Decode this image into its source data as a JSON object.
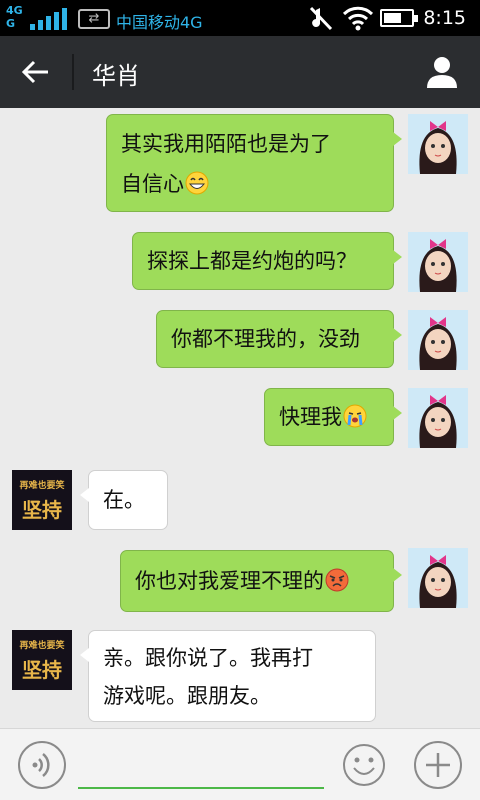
{
  "status_bar": {
    "network_badge_top": "4G",
    "network_badge_bottom": "G",
    "data_arrows": "⇄",
    "carrier": "中国移动4G",
    "battery_level": 0.6,
    "time": "8:15",
    "accent": "#2fb4e8"
  },
  "header": {
    "title": "华肖",
    "back_icon": "arrow-left-icon",
    "profile_icon": "person-icon"
  },
  "messages": [
    {
      "side": "right",
      "lines": [
        "其实我用陌陌也是为了",
        "自信心"
      ],
      "emoji": "grin-emoji"
    },
    {
      "side": "right",
      "lines": [
        "探探上都是约炮的吗？"
      ]
    },
    {
      "side": "right",
      "lines": [
        "你都不理我的，没劲"
      ]
    },
    {
      "side": "right",
      "lines": [
        "快理我"
      ],
      "emoji": "crying-emoji"
    },
    {
      "side": "left",
      "lines": [
        "在。"
      ]
    },
    {
      "side": "right",
      "lines": [
        "你也对我爱理不理的"
      ],
      "emoji": "angry-emoji"
    },
    {
      "side": "left",
      "lines": [
        "亲。跟你说了。我再打",
        "游戏呢。跟朋友。"
      ]
    }
  ],
  "avatar_left_text": [
    "再难也要笑",
    "坚持"
  ],
  "input_bar": {
    "input_value": "",
    "voice_icon": "voice-icon",
    "emoji_icon": "smiley-icon",
    "plus_icon": "plus-icon"
  },
  "colors": {
    "bubble_outgoing": "#9edc5a",
    "bubble_incoming": "#ffffff",
    "title_bar": "#2b2d30",
    "chat_background": "#ebebeb"
  }
}
